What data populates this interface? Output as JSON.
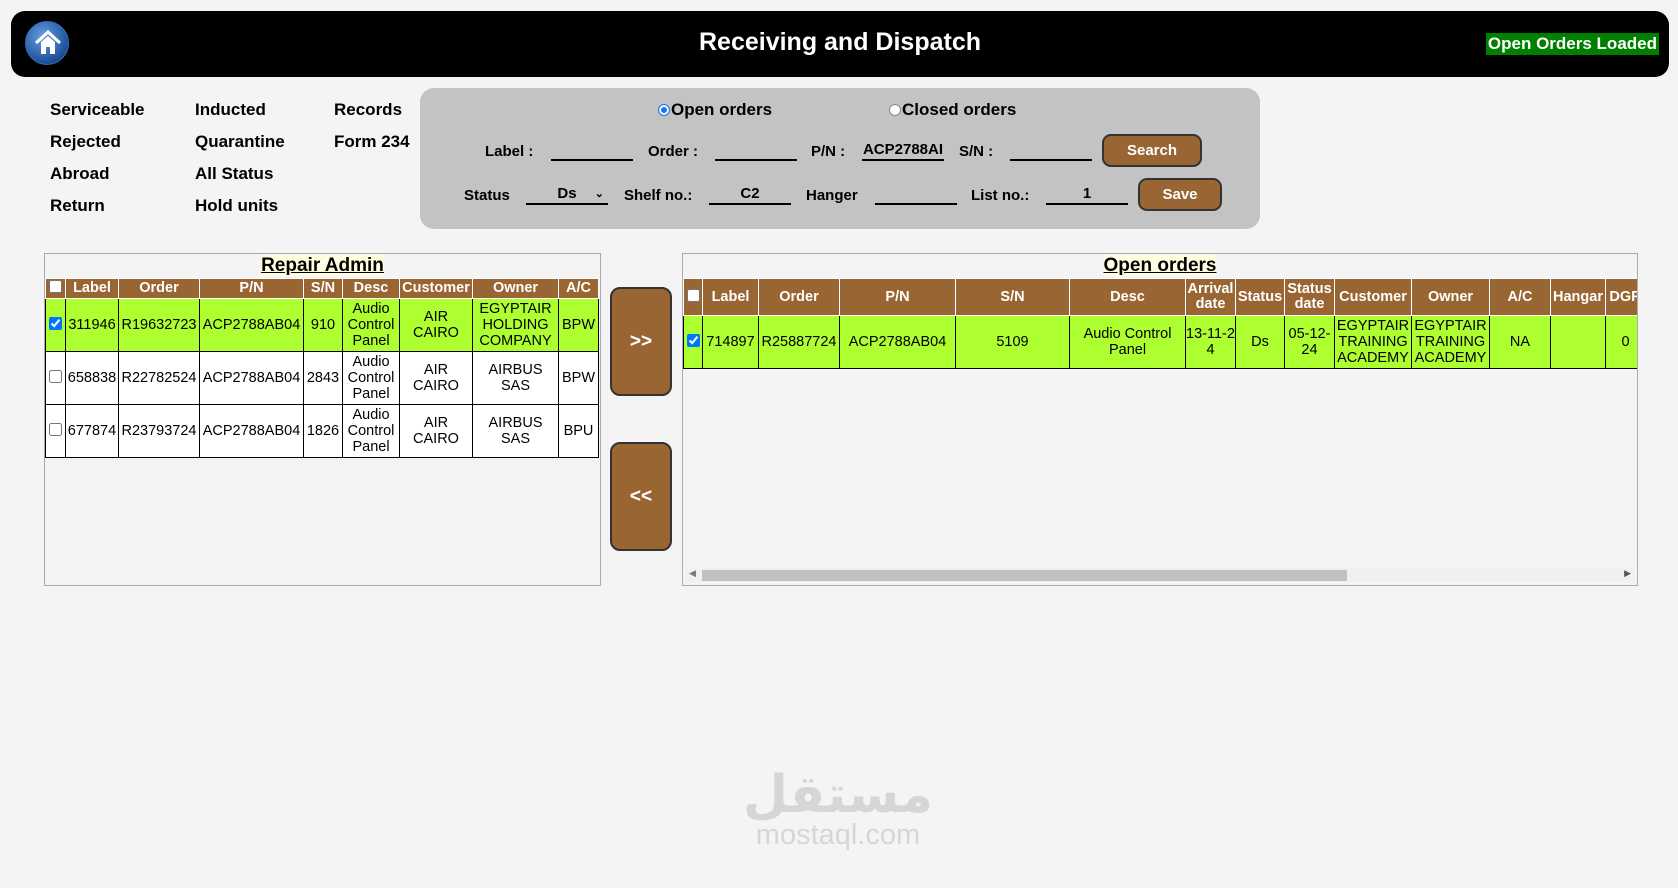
{
  "header": {
    "title": "Receiving and Dispatch",
    "status": "Open Orders Loaded",
    "home_icon": "home-icon"
  },
  "nav": [
    {
      "label": "Serviceable"
    },
    {
      "label": "Rejected"
    },
    {
      "label": "Abroad"
    },
    {
      "label": "Return"
    },
    {
      "label": "Inducted"
    },
    {
      "label": "Quarantine"
    },
    {
      "label": "All Status"
    },
    {
      "label": "Hold units"
    },
    {
      "label": "Records"
    },
    {
      "label": "Form 234"
    }
  ],
  "filters": {
    "radio_open": "Open orders",
    "radio_closed": "Closed orders",
    "selected": "Open orders",
    "label_lbl": "Label :",
    "label_val": "",
    "order_lbl": "Order :",
    "order_val": "",
    "pn_lbl": "P/N :",
    "pn_val": "ACP2788AI",
    "sn_lbl": "S/N :",
    "sn_val": "",
    "search": "Search",
    "status_lbl": "Status",
    "status_val": "Ds",
    "shelf_lbl": "Shelf no.:",
    "shelf_val": "C2",
    "hanger_lbl": "Hanger",
    "hanger_val": "",
    "list_lbl": "List no.:",
    "list_val": "1",
    "save": "Save"
  },
  "left": {
    "title": "Repair Admin",
    "columns": [
      "Label",
      "Order",
      "P/N",
      "S/N",
      "Desc",
      "Customer",
      "Owner",
      "A/C"
    ],
    "rows": [
      {
        "checked": true,
        "cells": [
          "311946",
          "R19632723",
          "ACP2788AB04",
          "910",
          "Audio Control Panel",
          "AIR CAIRO",
          "EGYPTAIR HOLDING COMPANY",
          "BPW"
        ]
      },
      {
        "checked": false,
        "cells": [
          "658838",
          "R22782524",
          "ACP2788AB04",
          "2843",
          "Audio Control Panel",
          "AIR CAIRO",
          "AIRBUS SAS",
          "BPW"
        ]
      },
      {
        "checked": false,
        "cells": [
          "677874",
          "R23793724",
          "ACP2788AB04",
          "1826",
          "Audio Control Panel",
          "AIR CAIRO",
          "AIRBUS SAS",
          "BPU"
        ]
      }
    ]
  },
  "move_right": ">>",
  "move_left": "<<",
  "right": {
    "title": "Open orders",
    "columns": [
      "Label",
      "Order",
      "P/N",
      "S/N",
      "Desc",
      "Arrival date",
      "Status",
      "Status date",
      "Customer",
      "Owner",
      "A/C",
      "Hangar",
      "DGR"
    ],
    "rows": [
      {
        "checked": true,
        "cells": [
          "714897",
          "R25887724",
          "ACP2788AB04",
          "5109",
          "Audio Control Panel",
          "13-11-24",
          "Ds",
          "05-12-24",
          "EGYPTAIR TRAINING ACADEMY",
          "EGYPTAIR TRAINING ACADEMY",
          "NA",
          "",
          "0"
        ]
      }
    ]
  },
  "watermark": {
    "arabic": "مستقل",
    "latin": "mostaql.com"
  },
  "colors": {
    "accent": "#996633",
    "selected_row": "#adff2f",
    "status_bg": "#008000"
  }
}
